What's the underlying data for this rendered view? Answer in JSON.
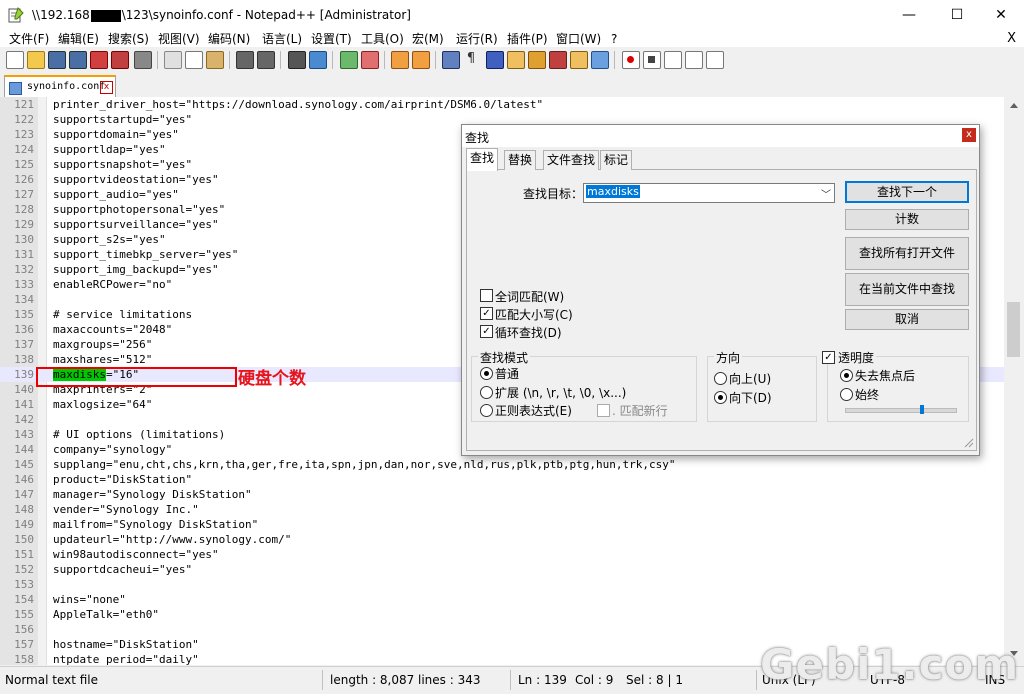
{
  "window": {
    "title_prefix": "\\\\192.168",
    "title_suffix": "\\123\\synoinfo.conf - Notepad++ [Administrator]",
    "minimize": "—",
    "maximize": "☐",
    "close": "✕"
  },
  "menu": [
    "文件(F)",
    "编辑(E)",
    "搜索(S)",
    "视图(V)",
    "编码(N)",
    "语言(L)",
    "设置(T)",
    "工具(O)",
    "宏(M)",
    "运行(R)",
    "插件(P)",
    "窗口(W)",
    "?"
  ],
  "menu_close": "X",
  "tab": {
    "label": "synoinfo.conf",
    "close": "x"
  },
  "lines": [
    {
      "n": "121",
      "text": "printer_driver_host=\"https://download.synology.com/airprint/DSM6.0/latest\""
    },
    {
      "n": "122",
      "text": "supportstartupd=\"yes\""
    },
    {
      "n": "123",
      "text": "supportdomain=\"yes\""
    },
    {
      "n": "124",
      "text": "supportldap=\"yes\""
    },
    {
      "n": "125",
      "text": "supportsnapshot=\"yes\""
    },
    {
      "n": "126",
      "text": "supportvideostation=\"yes\""
    },
    {
      "n": "127",
      "text": "support_audio=\"yes\""
    },
    {
      "n": "128",
      "text": "supportphotopersonal=\"yes\""
    },
    {
      "n": "129",
      "text": "supportsurveillance=\"yes\""
    },
    {
      "n": "130",
      "text": "support_s2s=\"yes\""
    },
    {
      "n": "131",
      "text": "support_timebkp_server=\"yes\""
    },
    {
      "n": "132",
      "text": "support_img_backupd=\"yes\""
    },
    {
      "n": "133",
      "text": "enableRCPower=\"no\""
    },
    {
      "n": "134",
      "text": ""
    },
    {
      "n": "135",
      "text": "# service limitations"
    },
    {
      "n": "136",
      "text": "maxaccounts=\"2048\""
    },
    {
      "n": "137",
      "text": "maxgroups=\"256\""
    },
    {
      "n": "138",
      "text": "maxshares=\"512\""
    },
    {
      "n": "139",
      "text": "=\"16\"",
      "hl": "maxdisks",
      "current": true
    },
    {
      "n": "140",
      "text": "maxprinters=\"2\""
    },
    {
      "n": "141",
      "text": "maxlogsize=\"64\""
    },
    {
      "n": "142",
      "text": ""
    },
    {
      "n": "143",
      "text": "# UI options (limitations)"
    },
    {
      "n": "144",
      "text": "company=\"synology\""
    },
    {
      "n": "145",
      "text": "supplang=\"enu,cht,chs,krn,tha,ger,fre,ita,spn,jpn,dan,nor,sve,nld,rus,plk,ptb,ptg,hun,trk,csy\""
    },
    {
      "n": "146",
      "text": "product=\"DiskStation\""
    },
    {
      "n": "147",
      "text": "manager=\"Synology DiskStation\""
    },
    {
      "n": "148",
      "text": "vender=\"Synology Inc.\""
    },
    {
      "n": "149",
      "text": "mailfrom=\"Synology DiskStation\""
    },
    {
      "n": "150",
      "text": "updateurl=\"http://www.synology.com/\""
    },
    {
      "n": "151",
      "text": "win98autodisconnect=\"yes\""
    },
    {
      "n": "152",
      "text": "supportdcacheui=\"yes\""
    },
    {
      "n": "153",
      "text": ""
    },
    {
      "n": "154",
      "text": "wins=\"none\""
    },
    {
      "n": "155",
      "text": "AppleTalk=\"eth0\""
    },
    {
      "n": "156",
      "text": ""
    },
    {
      "n": "157",
      "text": "hostname=\"DiskStation\""
    },
    {
      "n": "158",
      "text": "ntpdate_period=\"daily\""
    }
  ],
  "annotation": "硬盘个数",
  "dialog": {
    "title": "查找",
    "close": "x",
    "tabs": [
      "查找",
      "替换",
      "文件查找",
      "标记"
    ],
    "find_label": "查找目标：",
    "find_value": "maxdisks",
    "buttons": [
      "查找下一个",
      "计数",
      "查找所有打开文件",
      "在当前文件中查找",
      "取消"
    ],
    "options": [
      {
        "label": "全词匹配(W)",
        "checked": false
      },
      {
        "label": "匹配大小写(C)",
        "checked": true
      },
      {
        "label": "循环查找(D)",
        "checked": true
      }
    ],
    "search_mode": {
      "title": "查找模式",
      "options": [
        "普通",
        "扩展 (\\n, \\r, \\t, \\0, \\x...)",
        "正则表达式(E)"
      ],
      "selected": 0,
      "dotall": ". 匹配新行"
    },
    "direction": {
      "title": "方向",
      "options": [
        "向上(U)",
        "向下(D)"
      ],
      "selected": 1
    },
    "transparency": {
      "title": "透明度",
      "checked": true,
      "options": [
        "失去焦点后",
        "始终"
      ],
      "selected": 0,
      "level": 0.7
    }
  },
  "status": {
    "filetype": "Normal text file",
    "length": "length : 8,087",
    "lines": "lines : 343",
    "ln": "Ln : 139",
    "col": "Col : 9",
    "sel": "Sel : 8 | 1",
    "eol": "Unix (LF)",
    "enc": "UTF-8",
    "ins": "INS"
  },
  "watermark": "Gebi1.com"
}
